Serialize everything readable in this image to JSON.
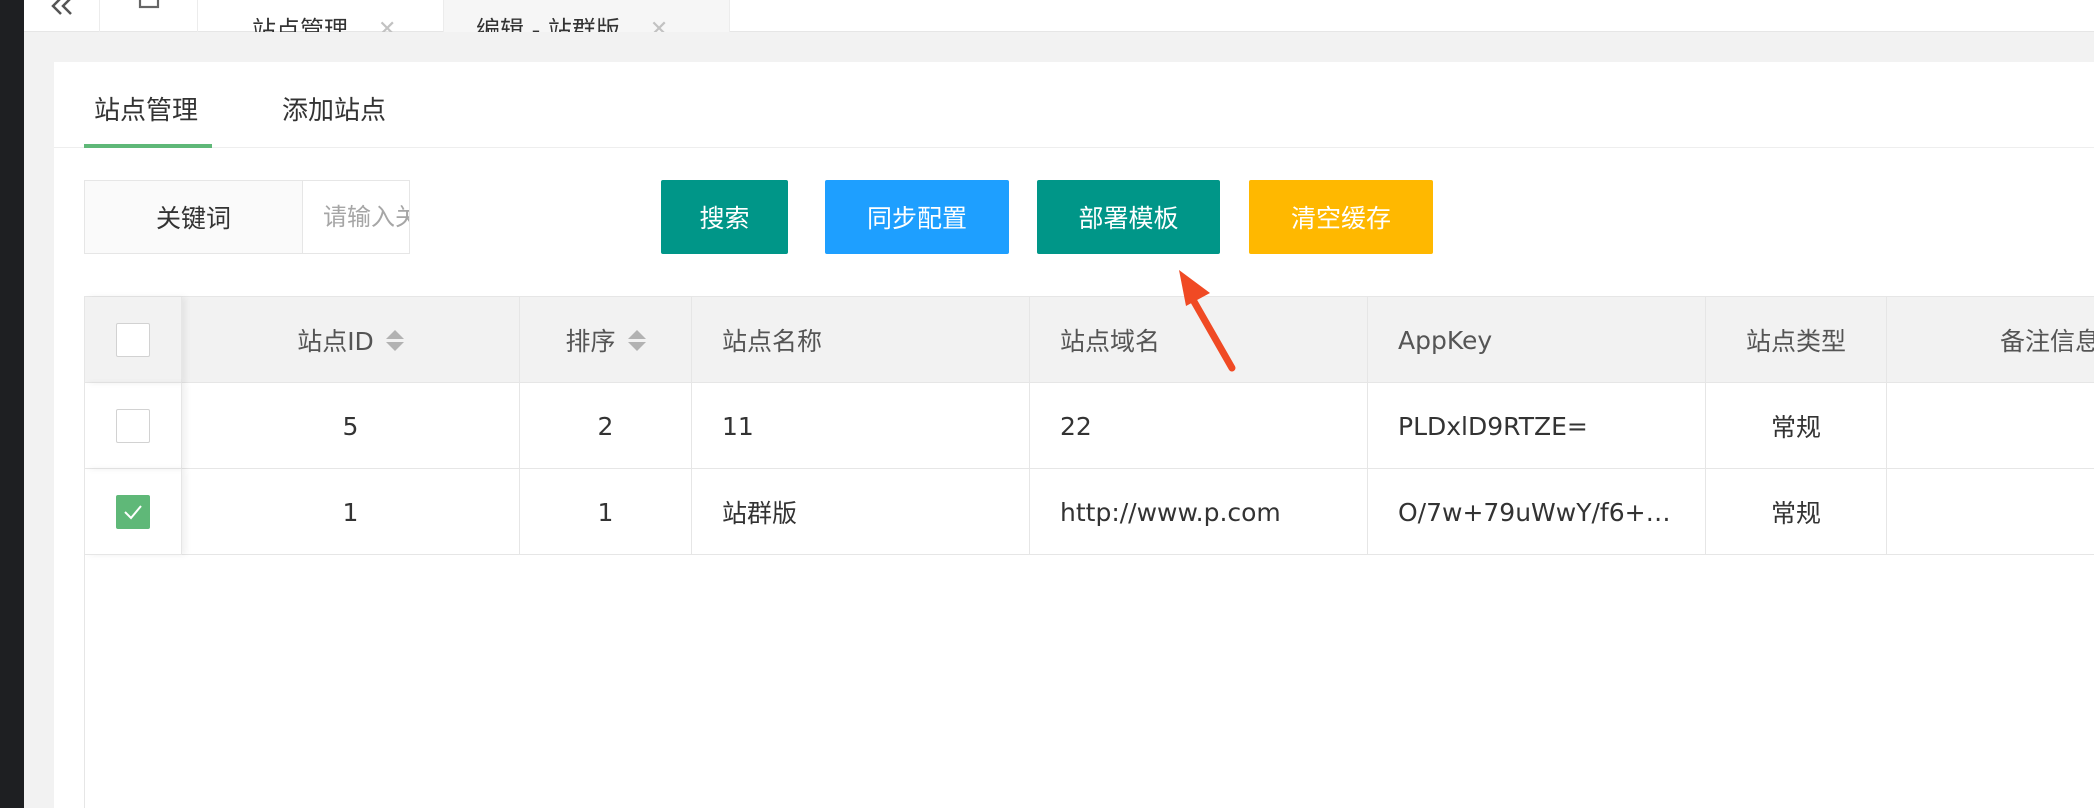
{
  "top_tabs": {
    "back_icon": "double-chevron-left-icon",
    "home_icon": "home-icon",
    "items": [
      {
        "label": "站点管理",
        "close": "✕"
      },
      {
        "label": "编辑 - 站群版",
        "close": "✕"
      }
    ]
  },
  "sub_tabs": [
    "站点管理",
    "添加站点"
  ],
  "search": {
    "label": "关键词",
    "placeholder": "请输入关键词",
    "value": ""
  },
  "buttons": {
    "search": "搜索",
    "sync": "同步配置",
    "deploy": "部署模板",
    "clear_cache": "清空缓存"
  },
  "colors": {
    "primary": "#009688",
    "normal": "#1e9fff",
    "warm": "#ffb800",
    "checked": "#5fb878",
    "annotation_arrow": "#f04a24"
  },
  "table": {
    "headers": {
      "id": "站点ID",
      "sort": "排序",
      "name": "站点名称",
      "domain": "站点域名",
      "appkey": "AppKey",
      "type": "站点类型",
      "remark": "备注信息"
    },
    "rows": [
      {
        "checked": false,
        "id": "5",
        "sort": "2",
        "name": "11",
        "domain": "22",
        "appkey": "PLDxlD9RTZE=",
        "type": "常规",
        "remark": ""
      },
      {
        "checked": true,
        "id": "1",
        "sort": "1",
        "name": "站群版",
        "domain": "http://www.p.com",
        "appkey": "O/7w+79uWwY/f6+…",
        "type": "常规",
        "remark": ""
      }
    ]
  }
}
